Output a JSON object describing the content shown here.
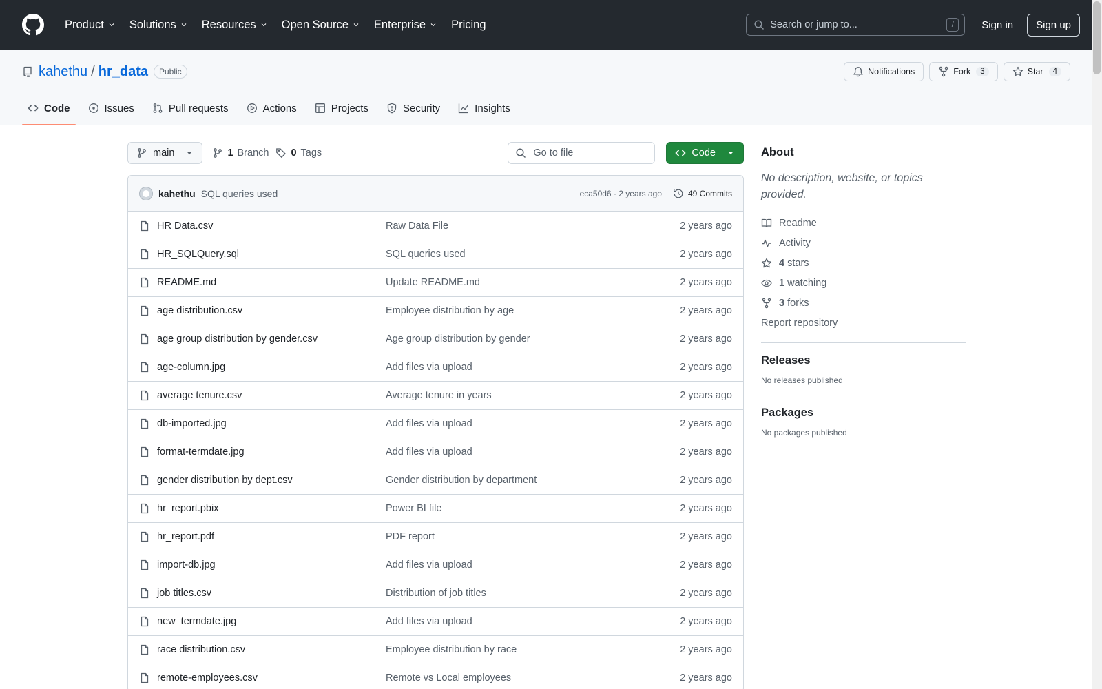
{
  "nav": {
    "items": [
      "Product",
      "Solutions",
      "Resources",
      "Open Source",
      "Enterprise",
      "Pricing"
    ],
    "search_placeholder": "Search or jump to...",
    "search_shortcut": "/",
    "signin": "Sign in",
    "signup": "Sign up"
  },
  "repo": {
    "owner": "kahethu",
    "separator": "/",
    "name": "hr_data",
    "visibility": "Public",
    "notifications": "Notifications",
    "fork_label": "Fork",
    "fork_count": "3",
    "star_label": "Star",
    "star_count": "4"
  },
  "tabs": [
    "Code",
    "Issues",
    "Pull requests",
    "Actions",
    "Projects",
    "Security",
    "Insights"
  ],
  "toolbar": {
    "branch": "main",
    "branch_count": "1",
    "branch_label": "Branch",
    "tag_count": "0",
    "tag_label": "Tags",
    "goto_placeholder": "Go to file",
    "code_label": "Code"
  },
  "commit": {
    "author": "kahethu",
    "message": "SQL queries used",
    "hash_time": "eca50d6 · 2 years ago",
    "commits": "49 Commits"
  },
  "files": [
    {
      "name": "HR Data.csv",
      "msg": "Raw Data File",
      "date": "2 years ago"
    },
    {
      "name": "HR_SQLQuery.sql",
      "msg": "SQL queries used",
      "date": "2 years ago"
    },
    {
      "name": "README.md",
      "msg": "Update README.md",
      "date": "2 years ago"
    },
    {
      "name": "age distribution.csv",
      "msg": "Employee distribution by age",
      "date": "2 years ago"
    },
    {
      "name": "age group distribution by gender.csv",
      "msg": "Age group distribution by gender",
      "date": "2 years ago"
    },
    {
      "name": "age-column.jpg",
      "msg": "Add files via upload",
      "date": "2 years ago"
    },
    {
      "name": "average tenure.csv",
      "msg": "Average tenure in years",
      "date": "2 years ago"
    },
    {
      "name": "db-imported.jpg",
      "msg": "Add files via upload",
      "date": "2 years ago"
    },
    {
      "name": "format-termdate.jpg",
      "msg": "Add files via upload",
      "date": "2 years ago"
    },
    {
      "name": "gender distribution by dept.csv",
      "msg": "Gender distribution by department",
      "date": "2 years ago"
    },
    {
      "name": "hr_report.pbix",
      "msg": "Power BI file",
      "date": "2 years ago"
    },
    {
      "name": "hr_report.pdf",
      "msg": "PDF report",
      "date": "2 years ago"
    },
    {
      "name": "import-db.jpg",
      "msg": "Add files via upload",
      "date": "2 years ago"
    },
    {
      "name": "job titles.csv",
      "msg": "Distribution of job titles",
      "date": "2 years ago"
    },
    {
      "name": "new_termdate.jpg",
      "msg": "Add files via upload",
      "date": "2 years ago"
    },
    {
      "name": "race distribution.csv",
      "msg": "Employee distribution by race",
      "date": "2 years ago"
    },
    {
      "name": "remote-employees.csv",
      "msg": "Remote vs Local employees",
      "date": "2 years ago"
    }
  ],
  "about": {
    "title": "About",
    "description": "No description, website, or topics provided.",
    "readme": "Readme",
    "activity": "Activity",
    "stars_count": "4",
    "stars_label": "stars",
    "watching_count": "1",
    "watching_label": "watching",
    "forks_count": "3",
    "forks_label": "forks",
    "report": "Report repository"
  },
  "releases": {
    "title": "Releases",
    "empty": "No releases published"
  },
  "packages": {
    "title": "Packages",
    "empty": "No packages published"
  },
  "icons": {
    "logo": "github-logo-icon",
    "file": "file-icon",
    "branch": "git-branch-icon",
    "tag": "tag-icon"
  },
  "colors": {
    "header_bg": "#24292f",
    "link": "#0969da",
    "code_button": "#1f883d",
    "active_tab_underline": "#fd8c73"
  }
}
